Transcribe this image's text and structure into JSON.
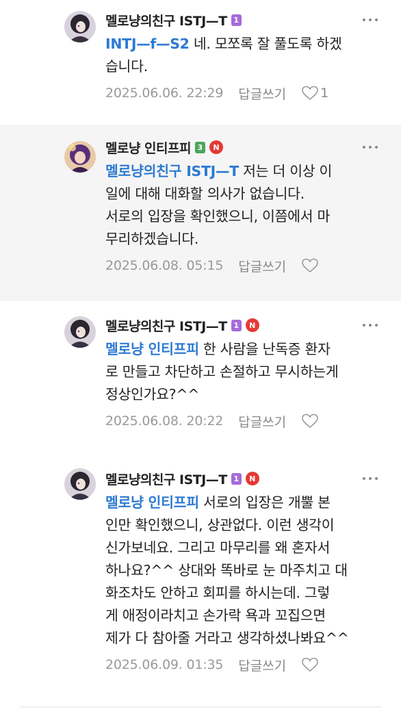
{
  "colors": {
    "mention": "#2d7ad2",
    "meta": "#999999",
    "badge_purple": "#a56bd8",
    "badge_green": "#4ca55a",
    "badge_n": "#e53935",
    "highlight_bg": "#f5f5f5"
  },
  "comments": [
    {
      "author": "멜로냥의친구 ISTJ—T",
      "level_badge": "1",
      "level_color": "#a56bd8",
      "has_n_badge": false,
      "mention": "INTJ—f—S2",
      "lines": [
        " 네. 모쪼록 잘 풀도록 하겠",
        "습니다."
      ],
      "date": "2025.06.06. 22:29",
      "reply_label": "답글쓰기",
      "like_count": "1",
      "highlight": false,
      "avatar_icon": "avatar-dark-icon"
    },
    {
      "author": "멜로냥 인티프피",
      "level_badge": "3",
      "level_color": "#4ca55a",
      "has_n_badge": true,
      "n_badge": "N",
      "mention": "멜로냥의친구 ISTJ—T",
      "lines": [
        " 저는 더 이상 이",
        "일에 대해 대화할 의사가 없습니다.",
        "서로의 입장을 확인했으니, 이쯤에서 마",
        "무리하겠습니다."
      ],
      "date": "2025.06.08. 05:15",
      "reply_label": "답글쓰기",
      "like_count": "",
      "highlight": true,
      "avatar_icon": "avatar-purple-icon"
    },
    {
      "author": "멜로냥의친구 ISTJ—T",
      "level_badge": "1",
      "level_color": "#a56bd8",
      "has_n_badge": true,
      "n_badge": "N",
      "mention": "멜로냥 인티프피",
      "lines": [
        " 한 사람을 난독증 환자",
        "로 만들고 차단하고 손절하고 무시하는게",
        "정상인가요?^^"
      ],
      "date": "2025.06.08. 20:22",
      "reply_label": "답글쓰기",
      "like_count": "",
      "highlight": false,
      "avatar_icon": "avatar-dark-icon"
    },
    {
      "author": "멜로냥의친구 ISTJ—T",
      "level_badge": "1",
      "level_color": "#a56bd8",
      "has_n_badge": true,
      "n_badge": "N",
      "mention": "멜로냥 인티프피",
      "lines": [
        " 서로의 입장은 개뿔 본",
        "인만 확인했으니, 상관없다. 이런 생각이",
        "신가보네요. 그리고 마무리를 왜 혼자서",
        "하나요?^^ 상대와 똑바로 눈 마주치고 대",
        "화조차도 안하고 회피를 하시는데. 그렇",
        "게 애정이라치고 손가락 욕과 꼬집으면",
        "제가 다 참아줄 거라고 생각하셨나봐요^^"
      ],
      "date": "2025.06.09. 01:35",
      "reply_label": "답글쓰기",
      "like_count": "",
      "highlight": false,
      "avatar_icon": "avatar-dark-icon"
    }
  ]
}
